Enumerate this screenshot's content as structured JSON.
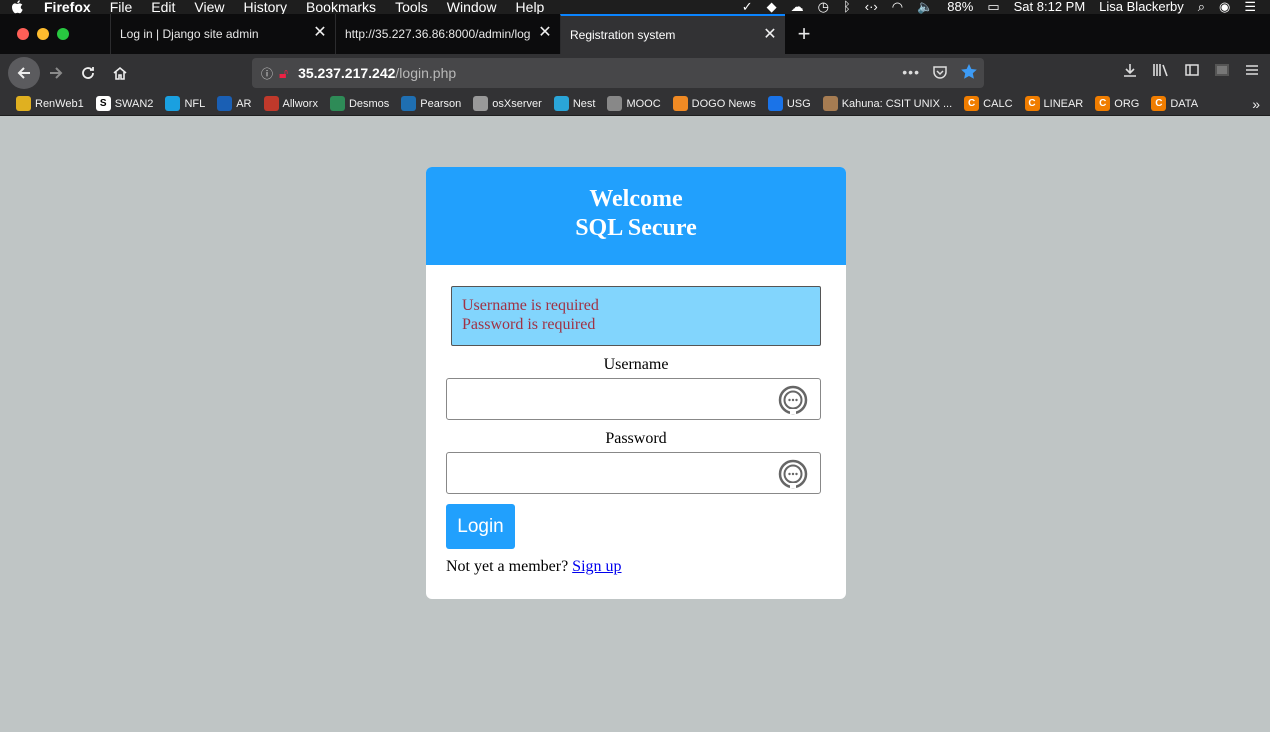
{
  "menubar": {
    "app_name": "Firefox",
    "items": [
      "File",
      "Edit",
      "View",
      "History",
      "Bookmarks",
      "Tools",
      "Window",
      "Help"
    ],
    "battery": "88%",
    "clock": "Sat 8:12 PM",
    "user": "Lisa Blackerby"
  },
  "tabs": [
    {
      "title": "Log in | Django site admin",
      "active": false
    },
    {
      "title": "http://35.227.36.86:8000/admin/log",
      "active": false
    },
    {
      "title": "Registration system",
      "active": true
    }
  ],
  "urlbar": {
    "host": "35.237.217.242",
    "path": "/login.php"
  },
  "bookmarks": [
    {
      "label": "RenWeb1",
      "icon": "renweb-icon",
      "color": "#e0b020"
    },
    {
      "label": "SWAN2",
      "icon": "swan-icon",
      "color": "#ffffff"
    },
    {
      "label": "NFL",
      "icon": "att-icon",
      "color": "#1aa0e0"
    },
    {
      "label": "AR",
      "icon": "ar-icon",
      "color": "#1a5fb4"
    },
    {
      "label": "Allworx",
      "icon": "allworx-icon",
      "color": "#c0392b"
    },
    {
      "label": "Desmos",
      "icon": "desmos-icon",
      "color": "#2e8b57"
    },
    {
      "label": "Pearson",
      "icon": "pearson-icon",
      "color": "#1f6fb2"
    },
    {
      "label": "osXserver",
      "icon": "apple-icon",
      "color": "#999999"
    },
    {
      "label": "Nest",
      "icon": "nest-icon",
      "color": "#2aa5d8"
    },
    {
      "label": "MOOC",
      "icon": "globe-icon",
      "color": "#888888"
    },
    {
      "label": "DOGO News",
      "icon": "dogo-icon",
      "color": "#f08a24"
    },
    {
      "label": "USG",
      "icon": "usg-icon",
      "color": "#1a73e8"
    },
    {
      "label": "Kahuna: CSIT UNIX ...",
      "icon": "kahuna-icon",
      "color": "#a67c52"
    },
    {
      "label": "CALC",
      "icon": "c-icon",
      "color": "#f07d00"
    },
    {
      "label": "LINEAR",
      "icon": "c-icon",
      "color": "#f07d00"
    },
    {
      "label": "ORG",
      "icon": "c-icon",
      "color": "#f07d00"
    },
    {
      "label": "DATA",
      "icon": "c-icon",
      "color": "#f07d00"
    }
  ],
  "card": {
    "title_line1": "Welcome",
    "title_line2": "SQL Secure",
    "errors": [
      "Username is required",
      "Password is required"
    ],
    "username_label": "Username",
    "username_value": "",
    "password_label": "Password",
    "password_value": "",
    "login_label": "Login",
    "signup_prompt": "Not yet a member?",
    "signup_link": "Sign up"
  },
  "colors": {
    "accent": "#21a0fd",
    "error_bg": "#82d5fd",
    "error_text": "#a03244",
    "page_bg": "#bfc5c5"
  }
}
